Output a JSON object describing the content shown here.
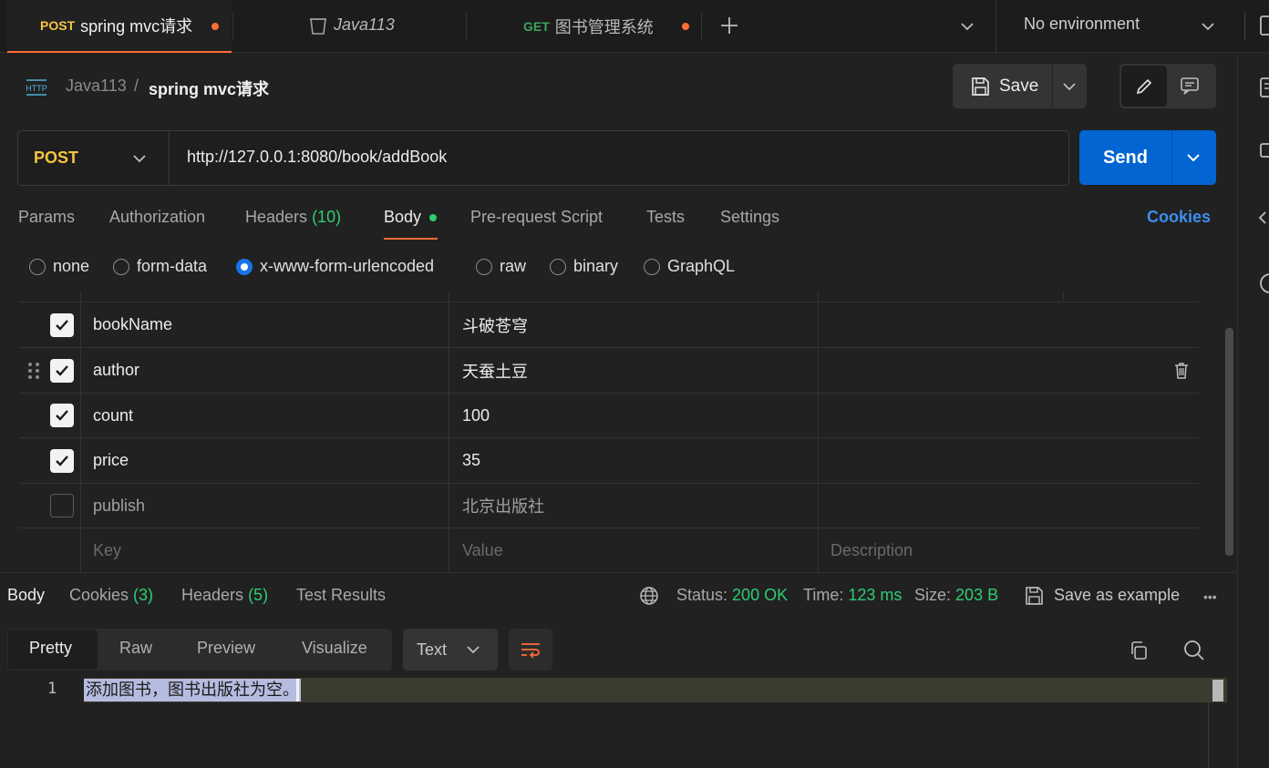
{
  "tabs": [
    {
      "method": "POST",
      "method_color": "#f5c542",
      "title": "spring mvc请求",
      "unsaved": true
    },
    {
      "title": "Java113"
    },
    {
      "method": "GET",
      "method_color": "#3fa15f",
      "title": "图书管理系统",
      "unsaved": true
    }
  ],
  "environment": {
    "label": "No environment"
  },
  "breadcrumb": {
    "collection": "Java113",
    "separator": "/",
    "request": "spring mvc请求",
    "http_badge": "HTTP"
  },
  "toolbar": {
    "save_label": "Save"
  },
  "request": {
    "method": "POST",
    "method_color": "#f5c542",
    "url": "http://127.0.0.1:8080/book/addBook",
    "send_label": "Send"
  },
  "request_tabs": {
    "params": "Params",
    "authorization": "Authorization",
    "headers": "Headers",
    "headers_count": "(10)",
    "body": "Body",
    "pre_request": "Pre-request Script",
    "tests": "Tests",
    "settings": "Settings",
    "cookies": "Cookies"
  },
  "body_types": {
    "selected": "x-www-form-urlencoded",
    "none": "none",
    "form_data": "form-data",
    "urlencoded": "x-www-form-urlencoded",
    "raw": "raw",
    "binary": "binary",
    "graphql": "GraphQL"
  },
  "form_rows": [
    {
      "key": "bookName",
      "value": "斗破苍穹",
      "enabled": true
    },
    {
      "key": "author",
      "value": "天蚕土豆",
      "enabled": true
    },
    {
      "key": "count",
      "value": "100",
      "enabled": true
    },
    {
      "key": "price",
      "value": "35",
      "enabled": true
    },
    {
      "key": "publish",
      "value": "北京出版社",
      "enabled": false
    }
  ],
  "form_placeholders": {
    "key": "Key",
    "value": "Value",
    "description": "Description"
  },
  "response_tabs": {
    "body": "Body",
    "cookies": "Cookies",
    "cookies_count": "(3)",
    "headers": "Headers",
    "headers_count": "(5)",
    "test_results": "Test Results"
  },
  "response_meta": {
    "status_label": "Status:",
    "status_value": "200 OK",
    "time_label": "Time:",
    "time_value": "123 ms",
    "size_label": "Size:",
    "size_value": "203 B",
    "save_example": "Save as example",
    "more": "•••"
  },
  "view_modes": {
    "pretty": "Pretty",
    "raw": "Raw",
    "preview": "Preview",
    "visualize": "Visualize",
    "selected": "Pretty"
  },
  "format": {
    "label": "Text"
  },
  "response_body": {
    "line_number": "1",
    "text": "添加图书，图书出版社为空。"
  },
  "colors": {
    "accent": "#ff6c37",
    "primary": "#0265d2",
    "status_green": "#2ecc71",
    "post_yellow": "#f5c542",
    "link_blue": "#3d8ef0"
  }
}
